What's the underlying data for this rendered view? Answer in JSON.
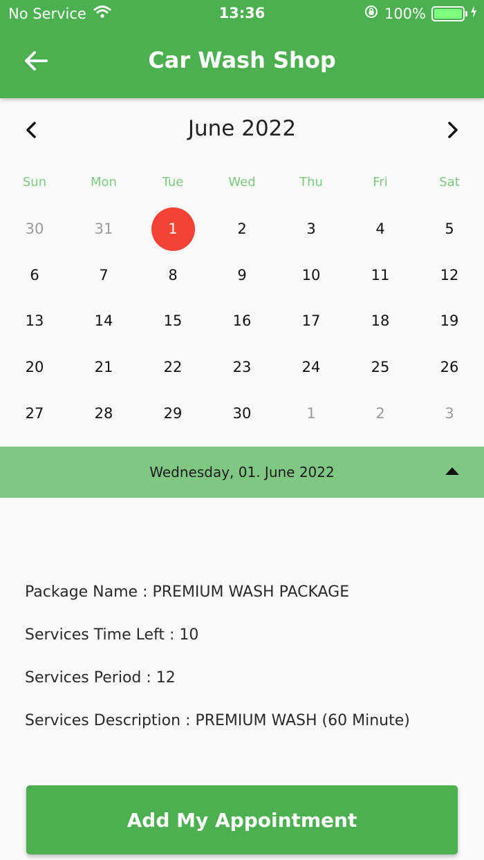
{
  "status_bar": {
    "carrier": "No Service",
    "time": "13:36",
    "battery_percent": "100%",
    "battery_level": 1.0
  },
  "app_bar": {
    "title": "Car Wash Shop",
    "back_icon": "arrow-left-icon"
  },
  "calendar": {
    "month_label": "June 2022",
    "prev_icon": "chevron-left-icon",
    "next_icon": "chevron-right-icon",
    "weekday_color": "#7cc97f",
    "selected_color": "#f44336",
    "weekdays": [
      "Sun",
      "Mon",
      "Tue",
      "Wed",
      "Thu",
      "Fri",
      "Sat"
    ],
    "weeks": [
      [
        {
          "label": "30",
          "muted": true
        },
        {
          "label": "31",
          "muted": true
        },
        {
          "label": "1",
          "selected": true
        },
        {
          "label": "2"
        },
        {
          "label": "3"
        },
        {
          "label": "4"
        },
        {
          "label": "5"
        }
      ],
      [
        {
          "label": "6"
        },
        {
          "label": "7"
        },
        {
          "label": "8"
        },
        {
          "label": "9"
        },
        {
          "label": "10"
        },
        {
          "label": "11"
        },
        {
          "label": "12"
        }
      ],
      [
        {
          "label": "13"
        },
        {
          "label": "14"
        },
        {
          "label": "15"
        },
        {
          "label": "16"
        },
        {
          "label": "17"
        },
        {
          "label": "18"
        },
        {
          "label": "19"
        }
      ],
      [
        {
          "label": "20"
        },
        {
          "label": "21"
        },
        {
          "label": "22"
        },
        {
          "label": "23"
        },
        {
          "label": "24"
        },
        {
          "label": "25"
        },
        {
          "label": "26"
        }
      ],
      [
        {
          "label": "27"
        },
        {
          "label": "28"
        },
        {
          "label": "29"
        },
        {
          "label": "30"
        },
        {
          "label": "1",
          "muted": true
        },
        {
          "label": "2",
          "muted": true
        },
        {
          "label": "3",
          "muted": true
        }
      ]
    ]
  },
  "selected_date_bar": {
    "text": "Wednesday, 01. June 2022",
    "toggle_icon": "triangle-up-icon",
    "background": "#81c784"
  },
  "package_info": {
    "name": "Package Name : PREMIUM WASH PACKAGE",
    "time_left": "Services Time Left :  10",
    "period": "Services Period : 12",
    "description": "Services Description : PREMIUM WASH (60 Minute)"
  },
  "primary_button": {
    "label": "Add My Appointment",
    "color": "#4caf50"
  }
}
